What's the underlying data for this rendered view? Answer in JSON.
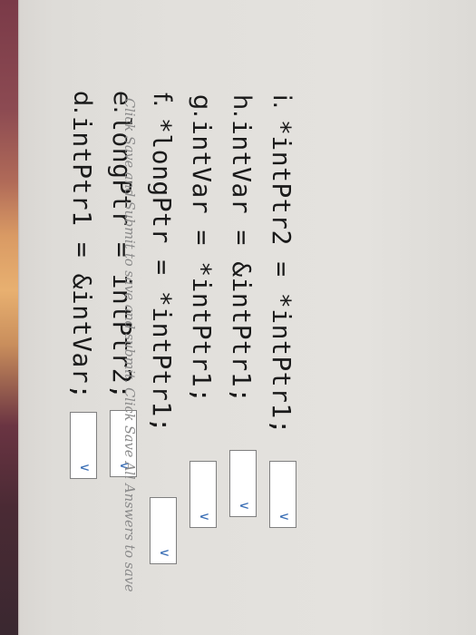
{
  "questions": [
    {
      "letter": "d.",
      "code": "intPtr1 = &intVar;"
    },
    {
      "letter": "e.",
      "code": "longPtr = intPtr2;"
    },
    {
      "letter": "f.",
      "code": "*longPtr = *intPtr1;"
    },
    {
      "letter": "g.",
      "code": "intVar = *intPtr1;"
    },
    {
      "letter": "h.",
      "code": "intVar = &intPtr1;"
    },
    {
      "letter": "i.",
      "code": "*intPtr2 = *intPtr1;"
    }
  ],
  "dropdown": {
    "value": "",
    "icon": "chevron-down-icon"
  },
  "footer_text": "Click Save and Submit to save and submit. Click Save All Answers to save"
}
